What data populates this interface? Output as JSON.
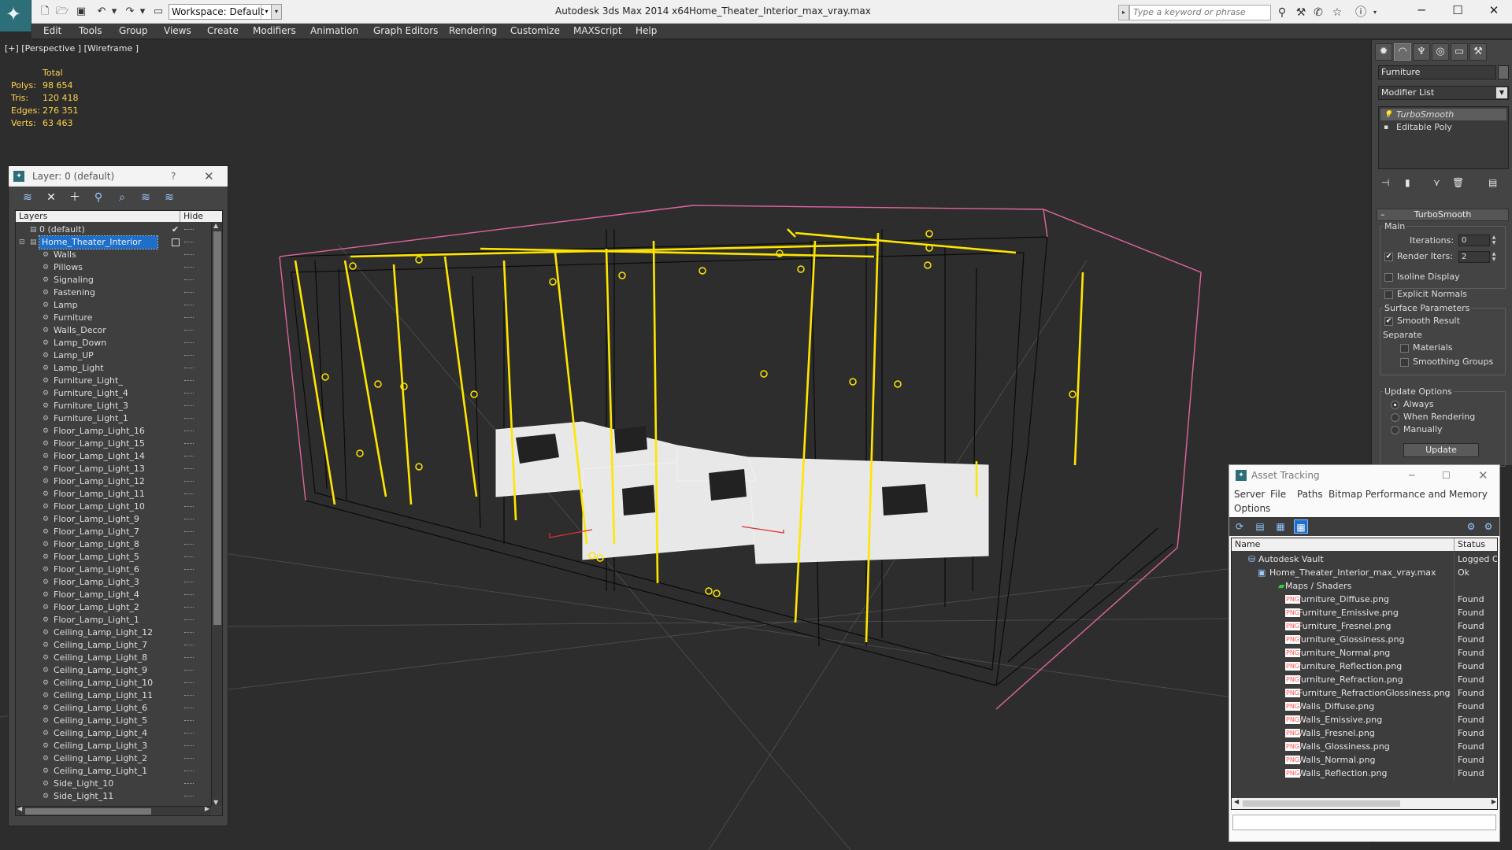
{
  "app": {
    "title": "Autodesk 3ds Max  2014 x64",
    "file": "Home_Theater_Interior_max_vray.max",
    "workspace": "Workspace: Default",
    "search_placeholder": "Type a keyword or phrase"
  },
  "menu": [
    "Edit",
    "Tools",
    "Group",
    "Views",
    "Create",
    "Modifiers",
    "Animation",
    "Graph Editors",
    "Rendering",
    "Customize",
    "MAXScript",
    "Help"
  ],
  "viewport": {
    "label": "[+] [Perspective ] [Wireframe ]",
    "stats": {
      "header": "Total",
      "polys_label": "Polys:",
      "polys": "98 654",
      "tris_label": "Tris:",
      "tris": "120 418",
      "edges_label": "Edges:",
      "edges": "276 351",
      "verts_label": "Verts:",
      "verts": "63 463"
    }
  },
  "layer_window": {
    "title": "Layer: 0 (default)",
    "help": "?",
    "col_layers": "Layers",
    "col_hide": "Hide",
    "top_layers": [
      "0 (default)",
      "Home_Theater_Interior"
    ],
    "children": [
      "Walls",
      "Pillows",
      "Signaling",
      "Fastening",
      "Lamp",
      "Furniture",
      "Walls_Decor",
      "Lamp_Down",
      "Lamp_UP",
      "Lamp_Light",
      "Furniture_Light_",
      "Furniture_Light_4",
      "Furniture_Light_3",
      "Furniture_Light_1",
      "Floor_Lamp_Light_16",
      "Floor_Lamp_Light_15",
      "Floor_Lamp_Light_14",
      "Floor_Lamp_Light_13",
      "Floor_Lamp_Light_12",
      "Floor_Lamp_Light_11",
      "Floor_Lamp_Light_10",
      "Floor_Lamp_Light_9",
      "Floor_Lamp_Light_7",
      "Floor_Lamp_Light_8",
      "Floor_Lamp_Light_5",
      "Floor_Lamp_Light_6",
      "Floor_Lamp_Light_3",
      "Floor_Lamp_Light_4",
      "Floor_Lamp_Light_2",
      "Floor_Lamp_Light_1",
      "Ceiling_Lamp_Light_12",
      "Ceiling_Lamp_Light_7",
      "Ceiling_Lamp_Light_8",
      "Ceiling_Lamp_Light_9",
      "Ceiling_Lamp_Light_10",
      "Ceiling_Lamp_Light_11",
      "Ceiling_Lamp_Light_6",
      "Ceiling_Lamp_Light_5",
      "Ceiling_Lamp_Light_4",
      "Ceiling_Lamp_Light_3",
      "Ceiling_Lamp_Light_2",
      "Ceiling_Lamp_Light_1",
      "Side_Light_10",
      "Side_Light_11"
    ]
  },
  "command_panel": {
    "object_name": "Furniture",
    "modifier_list": "Modifier List",
    "stack": [
      "TurboSmooth",
      "Editable Poly"
    ],
    "rollout_title": "TurboSmooth",
    "main_label": "Main",
    "iterations_label": "Iterations:",
    "iterations": "0",
    "render_iters_label": "Render Iters:",
    "render_iters": "2",
    "isoline": "Isoline Display",
    "explicit": "Explicit Normals",
    "surface_label": "Surface Parameters",
    "smooth_result": "Smooth Result",
    "separate_label": "Separate",
    "materials": "Materials",
    "smoothing_groups": "Smoothing Groups",
    "update_label": "Update Options",
    "always": "Always",
    "when_rendering": "When Rendering",
    "manually": "Manually",
    "update_btn": "Update"
  },
  "asset_window": {
    "title": "Asset Tracking",
    "menu": [
      "Server",
      "File",
      "Paths",
      "Bitmap Performance and Memory",
      "Options"
    ],
    "col_name": "Name",
    "col_status": "Status",
    "vault": {
      "name": "Autodesk Vault",
      "status": "Logged Ou"
    },
    "file": {
      "name": "Home_Theater_Interior_max_vray.max",
      "status": "Ok"
    },
    "maps_folder": "Maps / Shaders",
    "icon_text": "PNG",
    "maps": [
      {
        "name": "furniture_Diffuse.png",
        "status": "Found"
      },
      {
        "name": "Furniture_Emissive.png",
        "status": "Found"
      },
      {
        "name": "Furniture_Fresnel.png",
        "status": "Found"
      },
      {
        "name": "furniture_Glossiness.png",
        "status": "Found"
      },
      {
        "name": "furniture_Normal.png",
        "status": "Found"
      },
      {
        "name": "furniture_Reflection.png",
        "status": "Found"
      },
      {
        "name": "furniture_Refraction.png",
        "status": "Found"
      },
      {
        "name": "Furniture_RefractionGlossiness.png",
        "status": "Found"
      },
      {
        "name": "Walls_Diffuse.png",
        "status": "Found"
      },
      {
        "name": "Walls_Emissive.png",
        "status": "Found"
      },
      {
        "name": "Walls_Fresnel.png",
        "status": "Found"
      },
      {
        "name": "Walls_Glossiness.png",
        "status": "Found"
      },
      {
        "name": "Walls_Normal.png",
        "status": "Found"
      },
      {
        "name": "Walls_Reflection.png",
        "status": "Found"
      }
    ]
  },
  "colors": {
    "accent": "#1f6fc9",
    "wire_light": "#ffe600",
    "wire_box": "#e0659f",
    "stats_text": "#ffd34a"
  }
}
